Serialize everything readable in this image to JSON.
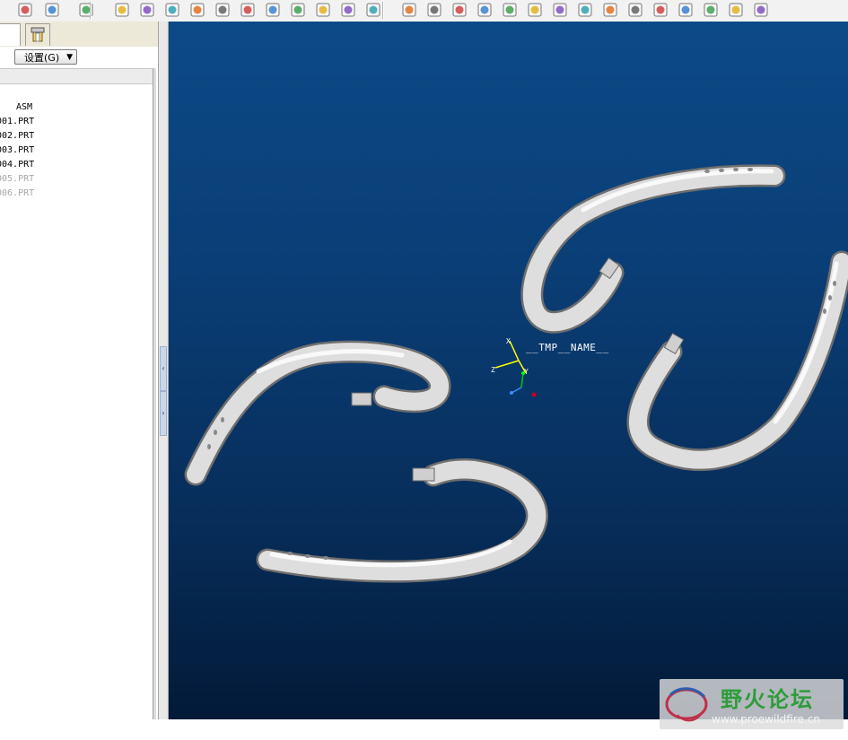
{
  "toolbar": {
    "icons": [
      "view-manager-icon",
      "layout-icon",
      "tree-columns-icon",
      "color-icon",
      "scene-icon",
      "texture-icon",
      "light-icon",
      "perspective-icon",
      "environment-icon",
      "render-room-icon",
      "render-setup-icon",
      "appearance-icon",
      "sphere-icon",
      "render-icon",
      "dimension-icon",
      "angle-icon",
      "section-icon",
      "clearance-icon",
      "curve-analysis-icon",
      "surface-analysis-icon",
      "curvature-icon",
      "shade-analysis-icon",
      "draft-icon",
      "offset-icon",
      "reflection-icon",
      "measure-icon",
      "settings-icon",
      "saved-view-icon",
      "zoom-icon"
    ]
  },
  "left_panel": {
    "settings_label": "设置(G)",
    "tree": [
      {
        "label": "ASM",
        "state": "active"
      },
      {
        "label": "001.PRT",
        "state": "active"
      },
      {
        "label": "002.PRT",
        "state": "active"
      },
      {
        "label": "003.PRT",
        "state": "active"
      },
      {
        "label": "004.PRT",
        "state": "active"
      },
      {
        "label": "005.PRT",
        "state": "dim"
      },
      {
        "label": "006.PRT",
        "state": "dim"
      }
    ]
  },
  "viewport": {
    "csys_label": "__TMP__NAME__",
    "axis_labels": {
      "x": "X",
      "y": "Y",
      "z": "Z"
    },
    "colors": {
      "background_top": "#0c4a87",
      "background_bottom": "#031a38",
      "part": "#d8d8d8"
    }
  },
  "watermark": {
    "text": "野火论坛",
    "url": "www.proewildfire.cn"
  }
}
